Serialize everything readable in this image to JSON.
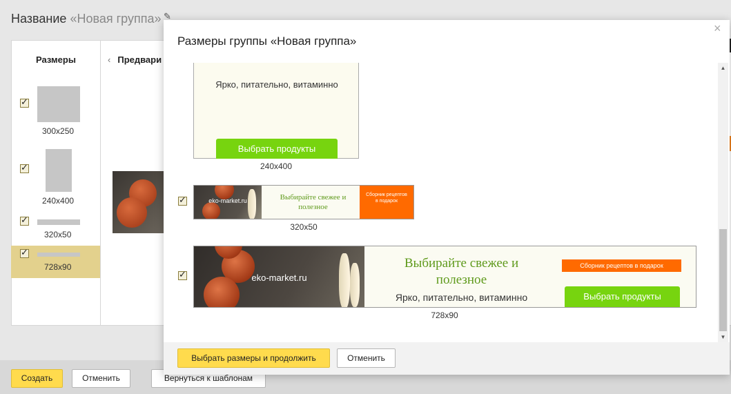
{
  "page": {
    "title_prefix": "Название",
    "title_group": "«Новая группа»",
    "sizes_header": "Размеры",
    "preview_header": "Предвари",
    "sizes": [
      {
        "label": "300x250",
        "checked": true
      },
      {
        "label": "240x400",
        "checked": true
      },
      {
        "label": "320x50",
        "checked": true
      },
      {
        "label": "728x90",
        "checked": true,
        "selected": true
      }
    ],
    "footer": {
      "create": "Создать",
      "cancel": "Отменить",
      "back": "Вернуться к шаблонам"
    }
  },
  "modal": {
    "title": "Размеры группы «Новая группа»",
    "close_icon": "close-icon",
    "banners": {
      "b240": {
        "tagline": "Ярко, питательно, витаминно",
        "cta": "Выбрать продукты",
        "label": "240x400"
      },
      "b320": {
        "logo": "eko-market.ru",
        "headline": "Выбирайте свежее и полезное",
        "badge": "Сборник рецептов в подарок",
        "label": "320x50",
        "checked": true
      },
      "b728": {
        "logo": "eko-market.ru",
        "headline": "Выбирайте свежее и полезное",
        "tagline": "Ярко, питательно, витаминно",
        "badge": "Сборник рецептов в подарок",
        "cta": "Выбрать продукты",
        "label": "728x90",
        "checked": true
      }
    },
    "footer": {
      "confirm": "Выбрать размеры и продолжить",
      "cancel": "Отменить"
    }
  },
  "colors": {
    "accent_yellow": "#ffdb4d",
    "cta_green": "#77d40f",
    "badge_orange": "#ff6a00",
    "headline_green": "#5f9a1c",
    "selected_row": "#e3d18d"
  }
}
